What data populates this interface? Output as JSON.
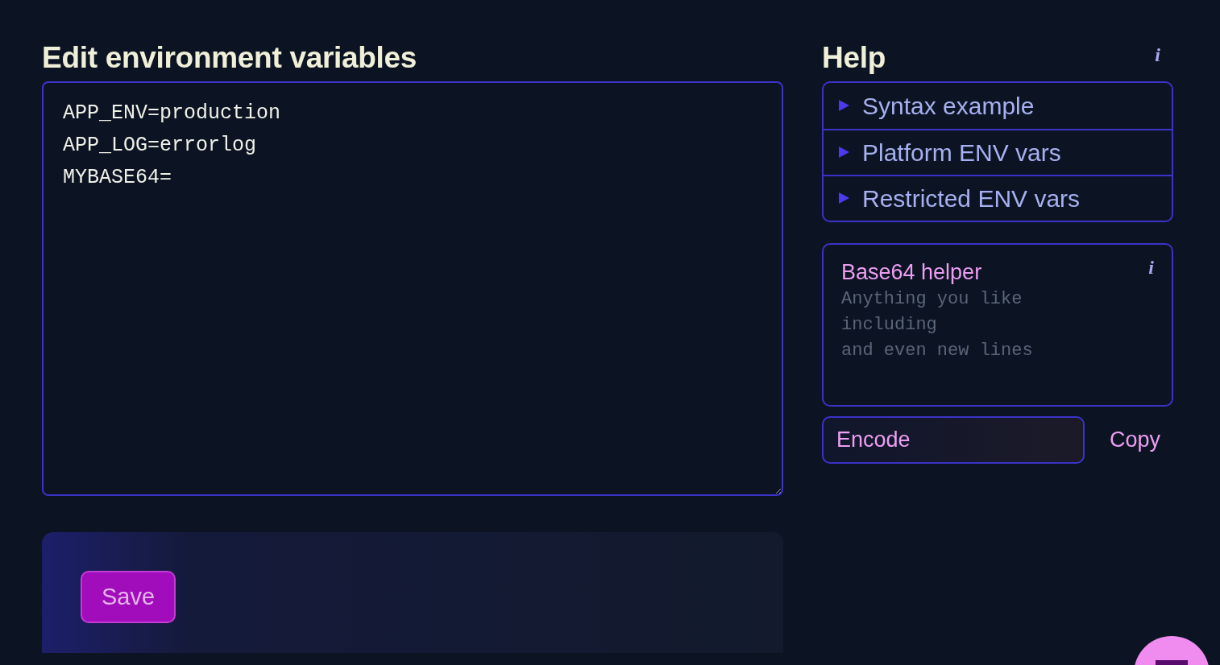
{
  "editor": {
    "title": "Edit environment variables",
    "value": "APP_ENV=production\nAPP_LOG=errorlog\nMYBASE64="
  },
  "save_button": "Save",
  "help": {
    "title": "Help",
    "info_icon": "i",
    "sections": [
      {
        "label": "Syntax example",
        "expanded": false
      },
      {
        "label": "Platform ENV vars",
        "expanded": false
      },
      {
        "label": "Restricted ENV vars",
        "expanded": false
      }
    ]
  },
  "base64_helper": {
    "label": "Base64 helper",
    "info_icon": "i",
    "placeholder": "Anything you like\nincluding \nand even new lines",
    "encode_button": "Encode",
    "copy_button": "Copy"
  }
}
